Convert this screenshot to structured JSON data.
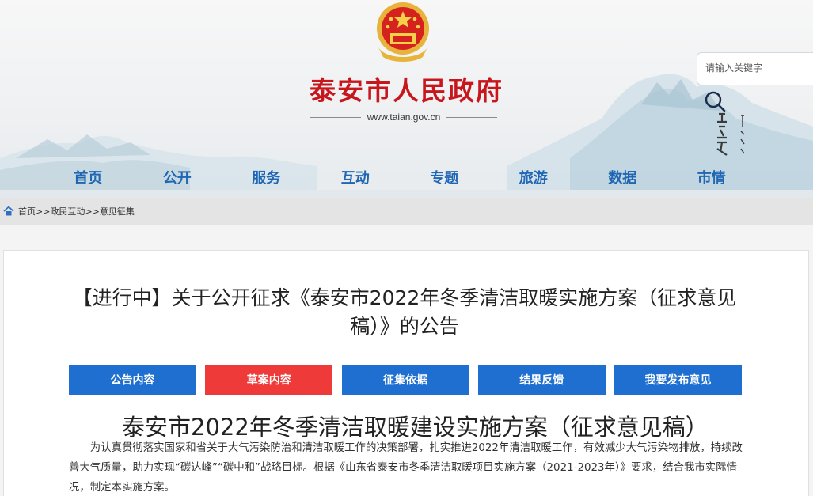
{
  "header": {
    "site_title": "泰安市人民政府",
    "site_url": "www.taian.gov.cn",
    "search_placeholder": "请输入关键字",
    "calligraphy_text": "五岳独尊"
  },
  "nav": {
    "items": [
      "首页",
      "公开",
      "服务",
      "互动",
      "专题",
      "旅游",
      "数据",
      "市情"
    ]
  },
  "breadcrumb": {
    "items": [
      "首页",
      "政民互动",
      "意见征集"
    ],
    "separator": ">>"
  },
  "notice": {
    "title": "【进行中】关于公开征求《泰安市2022年冬季清洁取暖实施方案（征求意见稿）》的公告",
    "tabs": [
      {
        "label": "公告内容",
        "active": false
      },
      {
        "label": "草案内容",
        "active": true
      },
      {
        "label": "征集依据",
        "active": false
      },
      {
        "label": "结果反馈",
        "active": false
      },
      {
        "label": "我要发布意见",
        "active": false
      }
    ]
  },
  "document": {
    "title": "泰安市2022年冬季清洁取暖建设实施方案（征求意见稿）",
    "paragraph": "为认真贯彻落实国家和省关于大气污染防治和清洁取暖工作的决策部署，扎实推进2022年清洁取暖工作，有效减少大气污染物排放，持续改善大气质量，助力实现“碳达峰”“碳中和”战略目标。根据《山东省泰安市冬季清洁取暖项目实施方案（2021-2023年）》要求，结合我市实际情况，制定本实施方案。"
  },
  "colors": {
    "brand_red": "#c8161d",
    "nav_blue": "#1f66b3",
    "tab_blue": "#1f6fd0",
    "tab_active_red": "#ef3a3a"
  }
}
